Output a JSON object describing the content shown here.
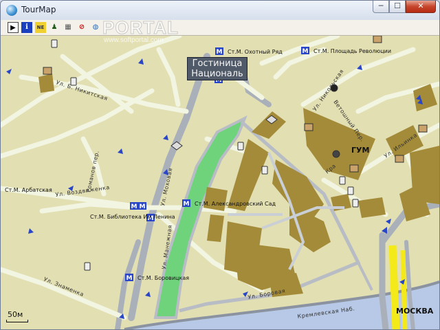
{
  "window": {
    "title": "TourMap",
    "minimize": "─",
    "maximize": "☐",
    "close": "✕"
  },
  "toolbar": {
    "items": [
      {
        "name": "pointer-tool",
        "glyph": "▶"
      },
      {
        "name": "info-tool",
        "glyph": "i"
      },
      {
        "name": "ne-tool",
        "glyph": "NE"
      },
      {
        "name": "person-tool",
        "glyph": "♟"
      },
      {
        "name": "layers-tool",
        "glyph": "▦"
      },
      {
        "name": "stop-tool",
        "glyph": "⊘"
      },
      {
        "name": "globe-tool",
        "glyph": "◍"
      }
    ]
  },
  "watermark": {
    "text": "PORTAL",
    "url": "www.softportal.com"
  },
  "map": {
    "hotel": {
      "line1": "Гостиница",
      "line2": "Националь"
    },
    "metro": [
      {
        "id": "okhotny",
        "label": "Ст.М. Охотный Ряд"
      },
      {
        "id": "revolution",
        "label": "Ст.М. Площадь Революции"
      },
      {
        "id": "arbatskaya",
        "label": "Ст.М. Арбатская"
      },
      {
        "id": "library",
        "label": "Ст.М. Библиотека Им Ленина"
      },
      {
        "id": "alexandrovsky",
        "label": "Ст.М. Александровский Сад"
      },
      {
        "id": "borovitskaya",
        "label": "Ст.М. Боровицкая"
      }
    ],
    "places": {
      "gum": "ГУМ",
      "moskva": "МОСКВА"
    },
    "streets": {
      "nikitskaya": "Ул. Б. Никитская",
      "romanov": "Романов пер.",
      "mokhovaya": "Ул. Моховая",
      "vozdvizhenka": "Ул. Воздвиженка",
      "manezhnaya": "Ул. Манежная",
      "znamenka": "Ул. Знаменка",
      "borovaya": "Ул. Боровая",
      "kremlin": "Кремлевская Наб.",
      "nikolskaya": "Ул. Никольская",
      "ilyinka": "Ул. Ильинка",
      "vetoshny": "Ветошный Пер.",
      "krasnaya": "Кра"
    },
    "scale": "50м",
    "colors": {
      "land": "#e2dfb2",
      "road": "#f2f5e1",
      "major_road": "#a9b0ba",
      "park": "#6fd37b",
      "building": "#a38b3a",
      "river": "#b7c9e6",
      "metro": "#2a46c8",
      "highlight": "#f4ea1a"
    }
  }
}
